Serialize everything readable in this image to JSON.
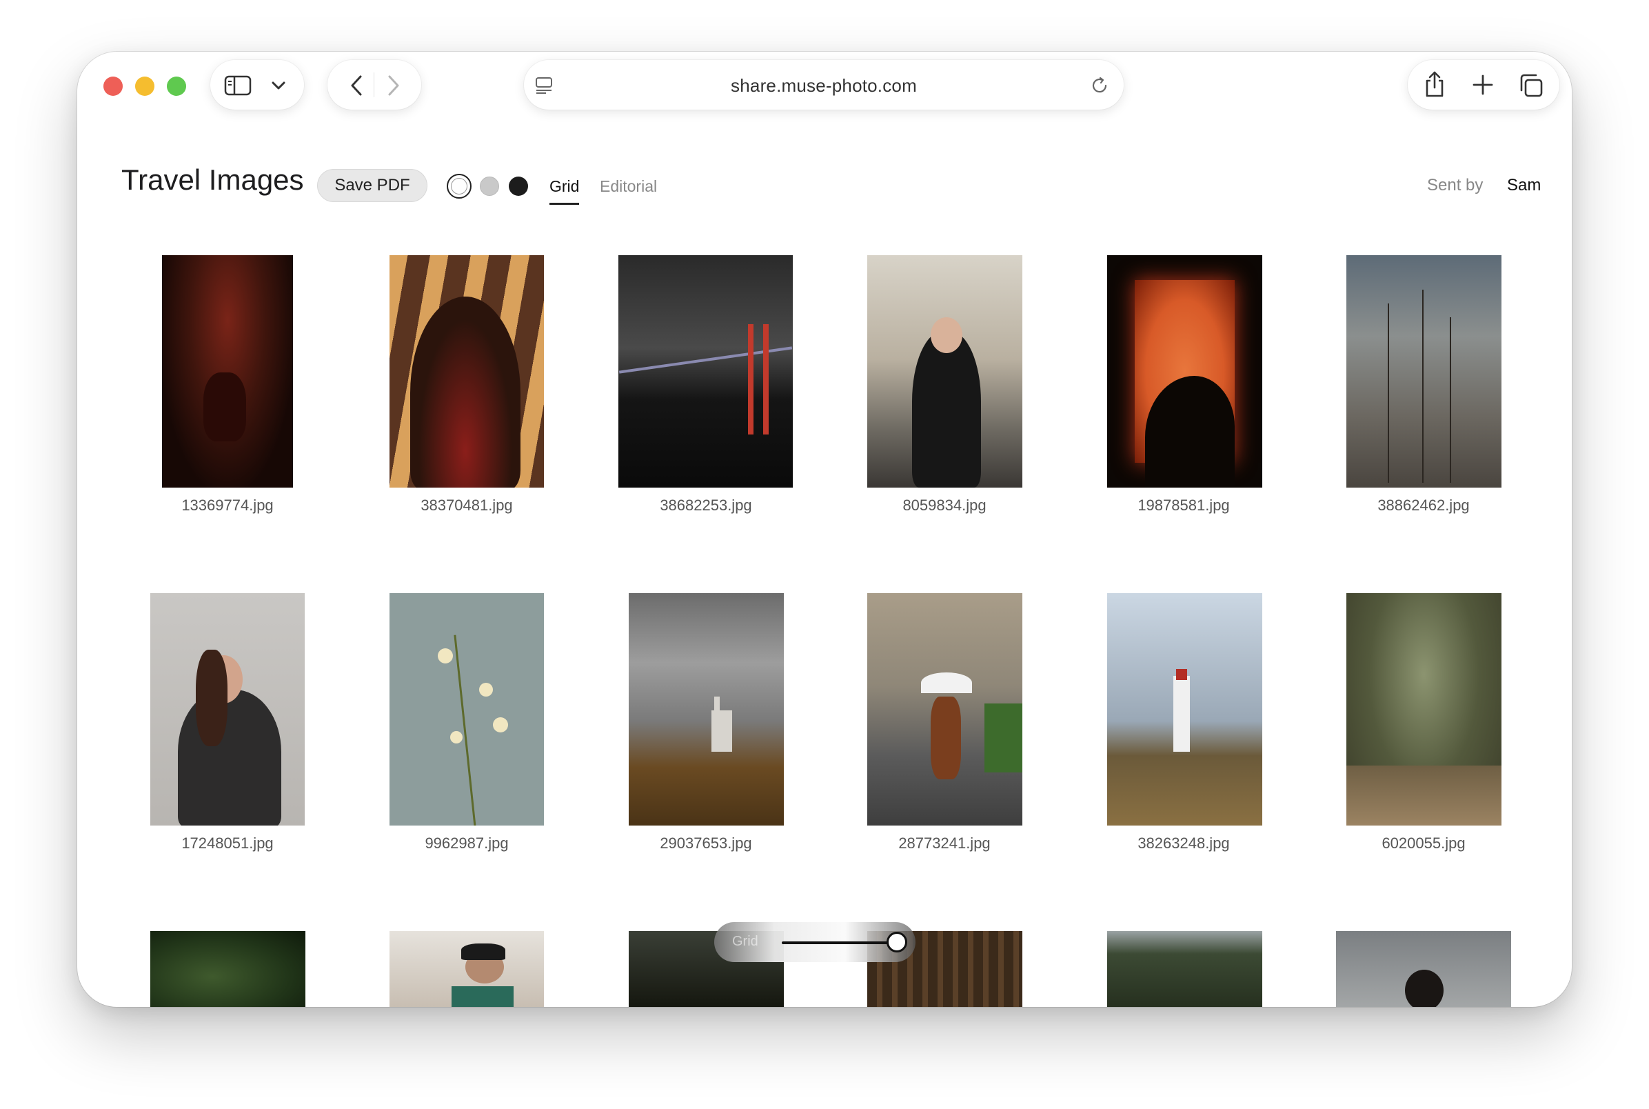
{
  "browser": {
    "url": "share.muse-photo.com",
    "icons": {
      "sidebar": "sidebar-icon",
      "chevron": "chevron-down-icon",
      "back": "back-icon",
      "forward": "forward-icon",
      "page_menu": "page-menu-icon",
      "reload": "reload-icon",
      "share": "share-icon",
      "new_tab": "plus-icon",
      "tabs": "tabs-overview-icon"
    }
  },
  "header": {
    "title": "Travel Images",
    "save_pdf_label": "Save PDF",
    "background_options": [
      "white",
      "grey",
      "black"
    ],
    "background_selected": "white",
    "tabs": [
      {
        "label": "Grid",
        "active": true
      },
      {
        "label": "Editorial",
        "active": false
      }
    ],
    "sent_by_label": "Sent by",
    "sent_by_name": "Sam"
  },
  "grid": {
    "images": [
      {
        "filename": "13369774.jpg"
      },
      {
        "filename": "38370481.jpg"
      },
      {
        "filename": "38682253.jpg"
      },
      {
        "filename": "8059834.jpg"
      },
      {
        "filename": "19878581.jpg"
      },
      {
        "filename": "38862462.jpg"
      },
      {
        "filename": "17248051.jpg"
      },
      {
        "filename": "9962987.jpg"
      },
      {
        "filename": "29037653.jpg"
      },
      {
        "filename": "28773241.jpg"
      },
      {
        "filename": "38263248.jpg"
      },
      {
        "filename": "6020055.jpg"
      }
    ]
  },
  "zoom_slider": {
    "label": "Grid",
    "value": 0.9
  }
}
